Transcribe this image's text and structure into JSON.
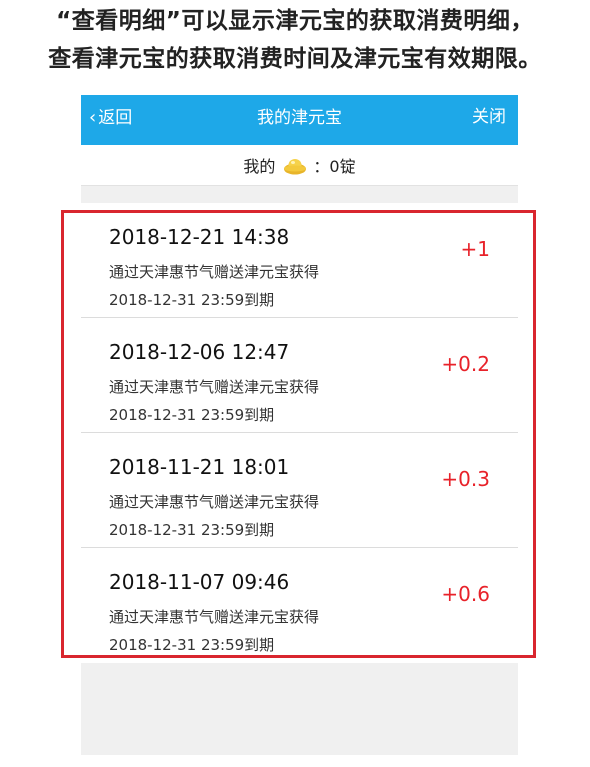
{
  "caption": {
    "line1": "“查看明细”可以显示津元宝的获取消费明细，",
    "line2": "查看津元宝的获取消费时间及津元宝有效期限。"
  },
  "navbar": {
    "back_label": "返回",
    "title": "我的津元宝",
    "close_label": "关闭",
    "background": "#1ea8e8"
  },
  "balance": {
    "prefix": "我的",
    "icon": "gold-ingot-icon",
    "value": "：0锭"
  },
  "records": [
    {
      "time": "2018-12-21 14:38",
      "source": "通过天津惠节气赠送津元宝获得",
      "expiry": "2018-12-31 23:59到期",
      "amount": "+1"
    },
    {
      "time": "2018-12-06 12:47",
      "source": "通过天津惠节气赠送津元宝获得",
      "expiry": "2018-12-31 23:59到期",
      "amount": "+0.2"
    },
    {
      "time": "2018-11-21 18:01",
      "source": "通过天津惠节气赠送津元宝获得",
      "expiry": "2018-12-31 23:59到期",
      "amount": "+0.3"
    },
    {
      "time": "2018-11-07 09:46",
      "source": "通过天津惠节气赠送津元宝获得",
      "expiry": "2018-12-31 23:59到期",
      "amount": "+0.6"
    }
  ],
  "colors": {
    "amount": "#e8222a",
    "highlight_border": "#d9262e"
  }
}
